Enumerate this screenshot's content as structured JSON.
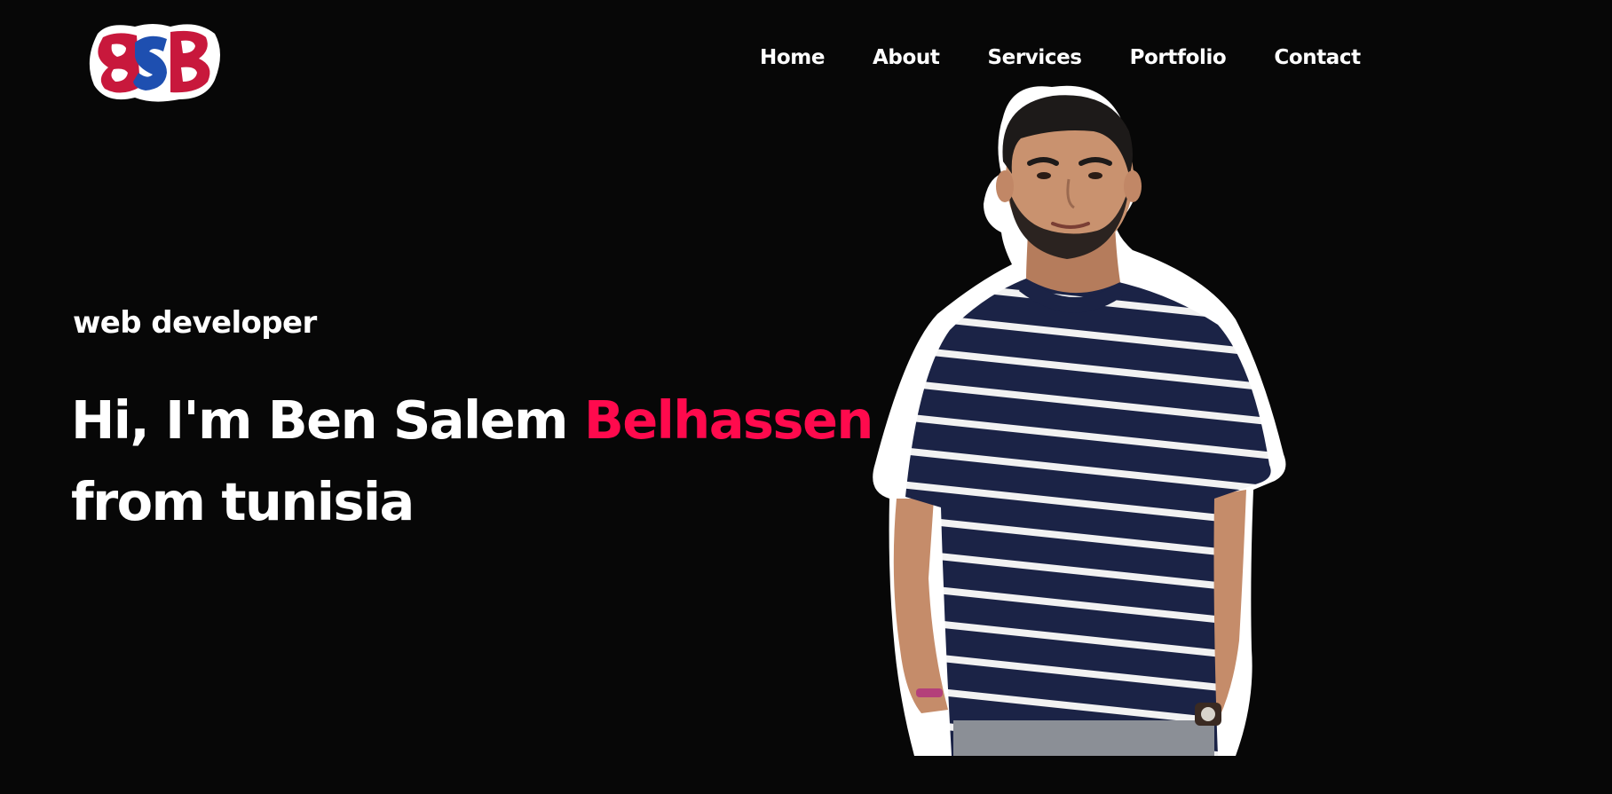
{
  "logo": {
    "text": "BSB",
    "colors": {
      "outer": "#c8183c",
      "inner": "#1e4fb0",
      "outline": "#ffffff"
    }
  },
  "nav": {
    "items": [
      {
        "label": "Home"
      },
      {
        "label": "About"
      },
      {
        "label": "Services"
      },
      {
        "label": "Portfolio"
      },
      {
        "label": "Contact"
      }
    ]
  },
  "hero": {
    "subtitle": "web developer",
    "headline_prefix": "Hi, I'm Ben Salem ",
    "headline_accent": "Belhassen",
    "headline_line2": "from tunisia",
    "accent_color": "#ff0a4d"
  },
  "portrait": {
    "icon": "person-portrait"
  },
  "colors": {
    "background": "#070707",
    "text": "#ffffff",
    "accent": "#ff0a4d"
  }
}
